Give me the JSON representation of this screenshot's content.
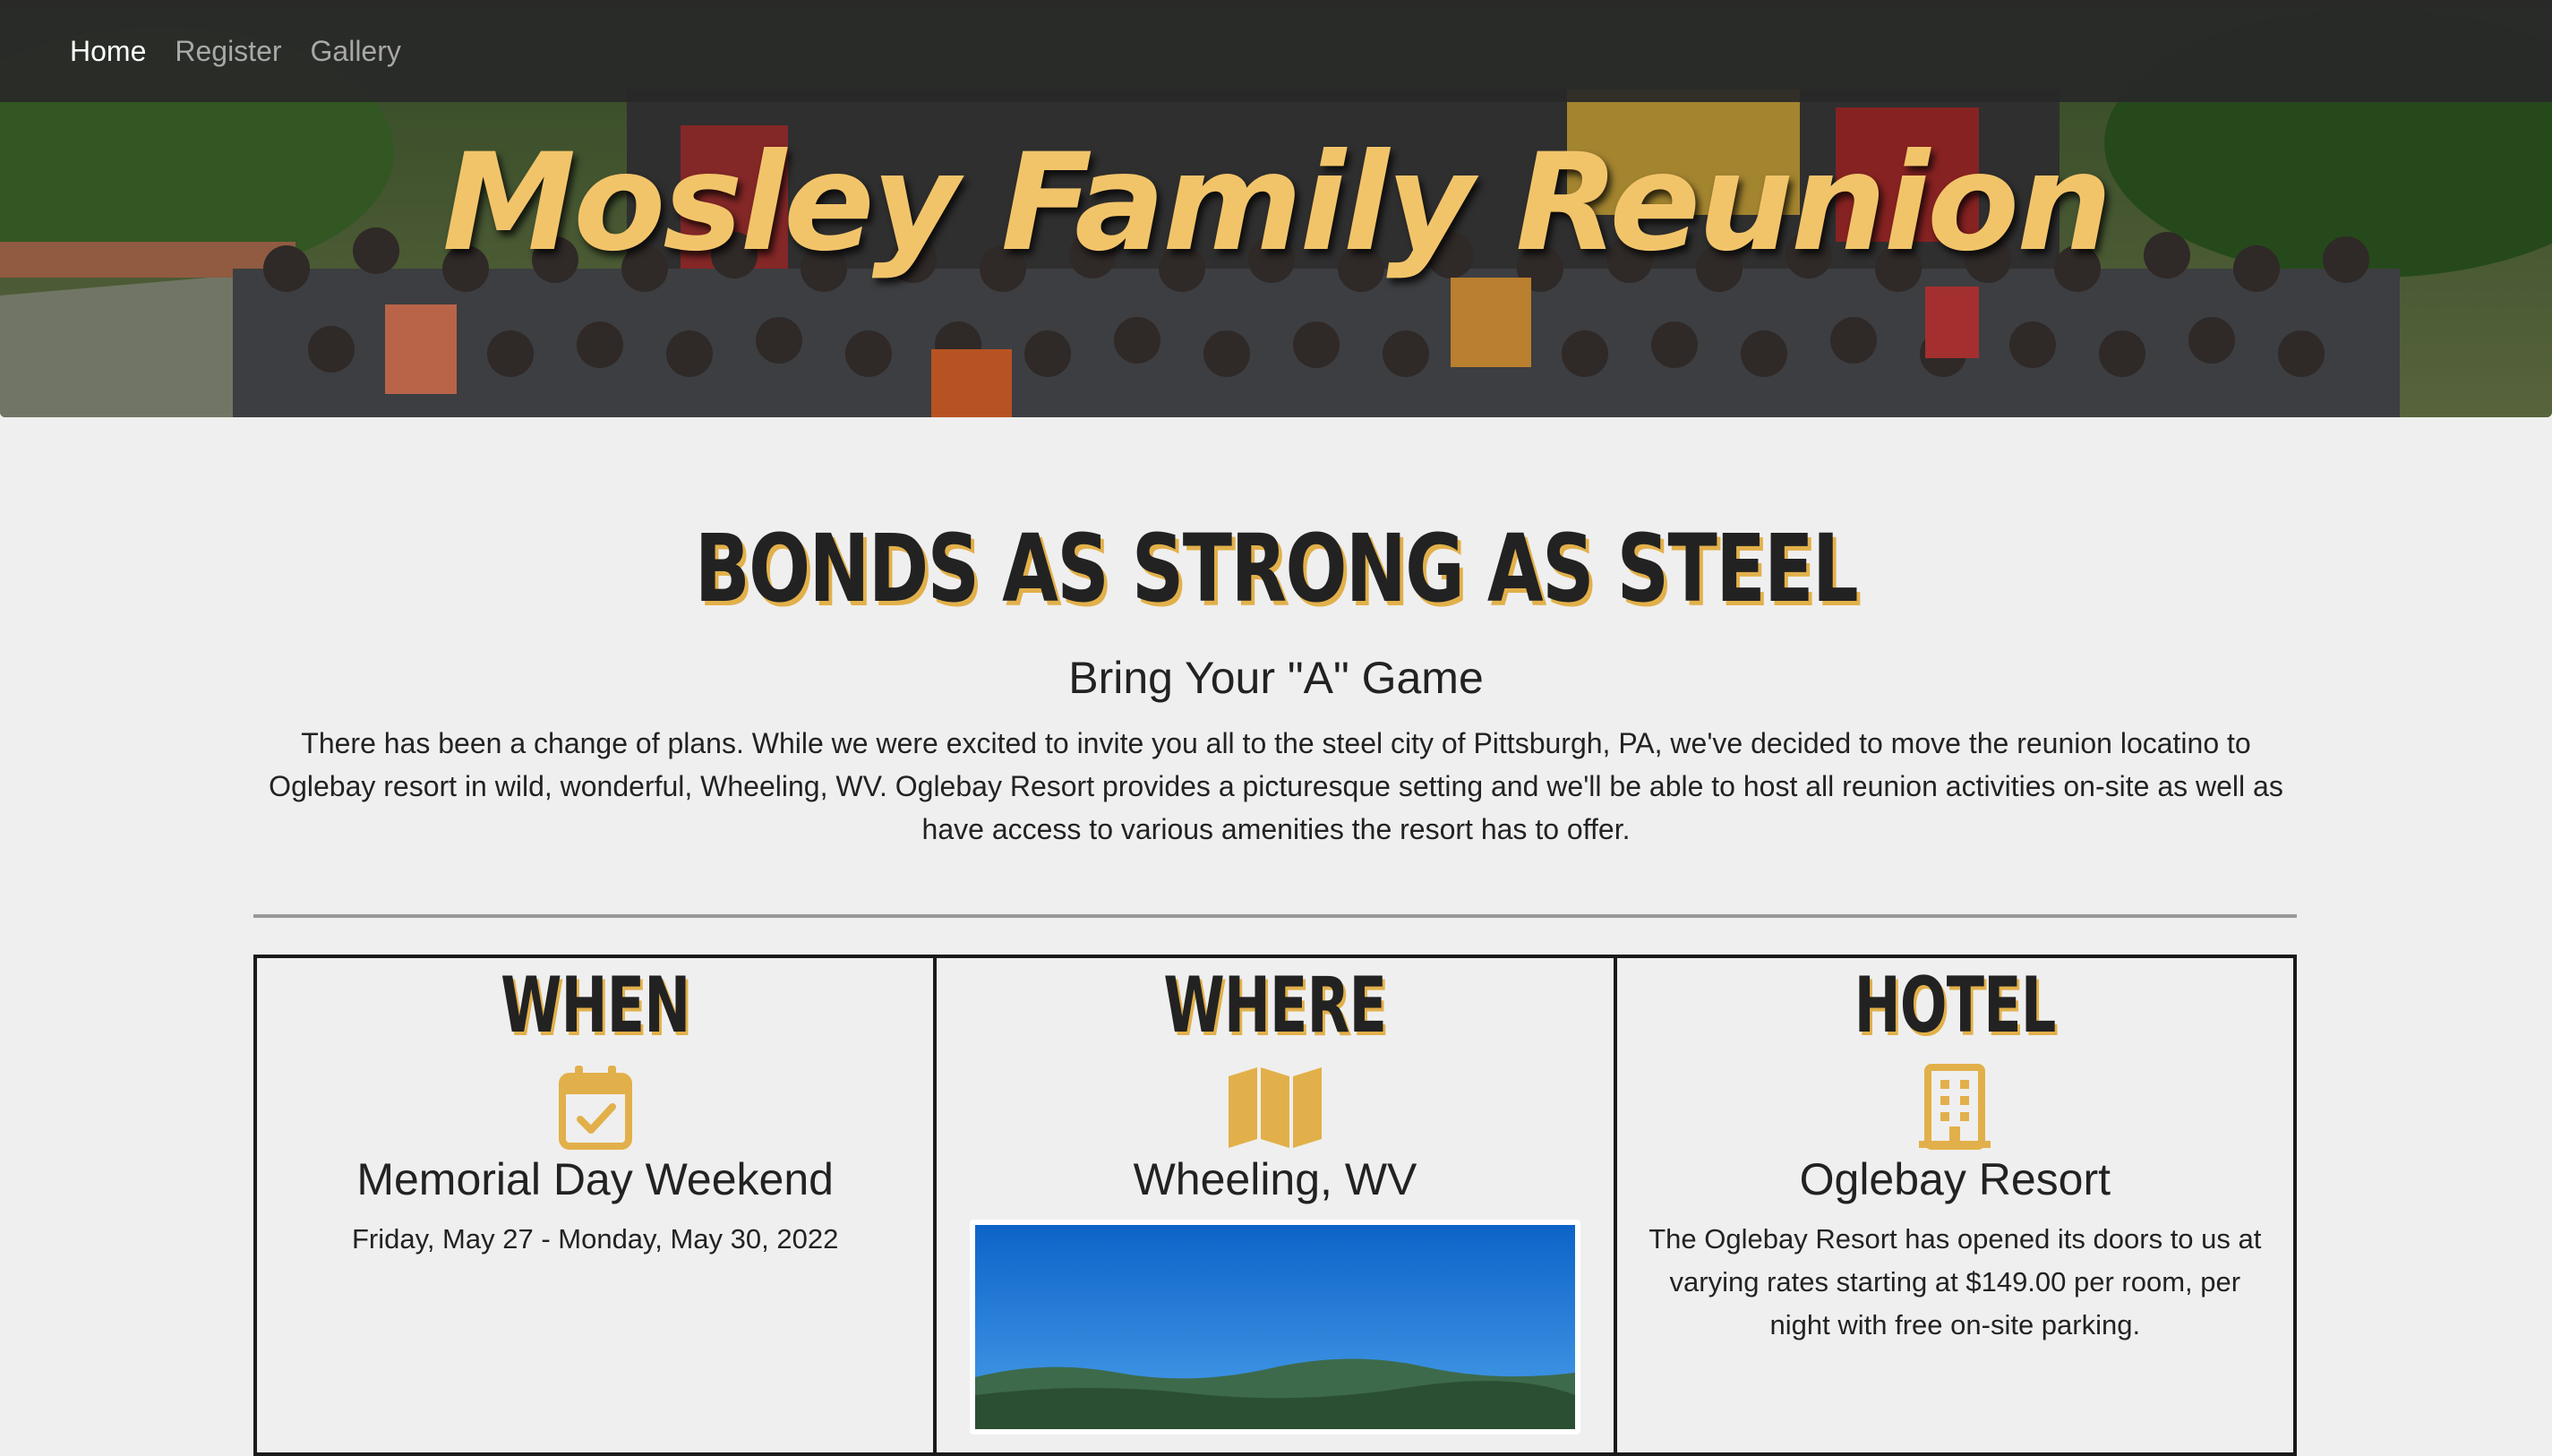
{
  "nav": {
    "items": [
      {
        "label": "Home",
        "active": true
      },
      {
        "label": "Register",
        "active": false
      },
      {
        "label": "Gallery",
        "active": false
      }
    ]
  },
  "hero": {
    "title": "Mosley Family Reunion"
  },
  "main": {
    "tagline": "BONDS AS STRONG AS STEEL",
    "subheading": "Bring Your \"A\" Game",
    "intro": "There has been a change of plans. While we were excited to invite you all to the steel city of Pittsburgh, PA, we've decided to move the reunion locatino to Oglebay resort in wild, wonderful, Wheeling, WV. Oglebay Resort provides a picturesque setting and we'll be able to host all reunion activities on-site as well as have access to various amenities the resort has to offer."
  },
  "cards": [
    {
      "heading": "WHEN",
      "icon": "calendar-check-icon",
      "title": "Memorial Day Weekend",
      "text": "Friday, May 27 - Monday, May 30, 2022"
    },
    {
      "heading": "WHERE",
      "icon": "map-icon",
      "title": "Wheeling, WV",
      "text": ""
    },
    {
      "heading": "HOTEL",
      "icon": "building-icon",
      "title": "Oglebay Resort",
      "text": "The Oglebay Resort has opened its doors to us at varying rates starting at $149.00 per room, per night with free on-site parking."
    }
  ],
  "colors": {
    "accent": "#e2b04a",
    "hero_title": "#f2c46a",
    "background": "#efefef",
    "navbar": "#282828"
  }
}
